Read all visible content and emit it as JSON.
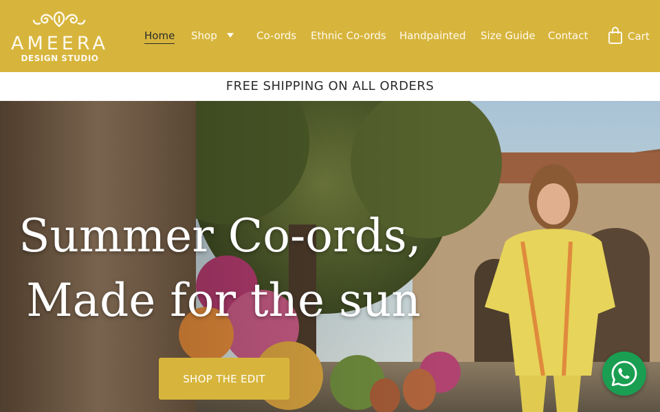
{
  "brand": {
    "name": "AMEERA",
    "tagline": "DESIGN STUDIO"
  },
  "nav": {
    "items": [
      {
        "label": "Home",
        "active": true
      },
      {
        "label": "Shop",
        "has_dropdown": true
      },
      {
        "label": "Co-ords"
      },
      {
        "label": "Ethnic Co-ords"
      },
      {
        "label": "Handpainted"
      },
      {
        "label": "Size Guide"
      },
      {
        "label": "Contact"
      }
    ],
    "cart_label": "Cart"
  },
  "announcement": "FREE SHIPPING ON ALL ORDERS",
  "hero": {
    "title_line1": "Summer Co-ords,",
    "title_line2": "Made for the sun",
    "cta_label": "SHOP THE EDIT"
  },
  "colors": {
    "brand_yellow": "#d7b53c",
    "whatsapp_green": "#1a9f52"
  },
  "icons": [
    "ornament-icon",
    "chevron-down-icon",
    "shopping-bag-icon",
    "whatsapp-icon"
  ]
}
